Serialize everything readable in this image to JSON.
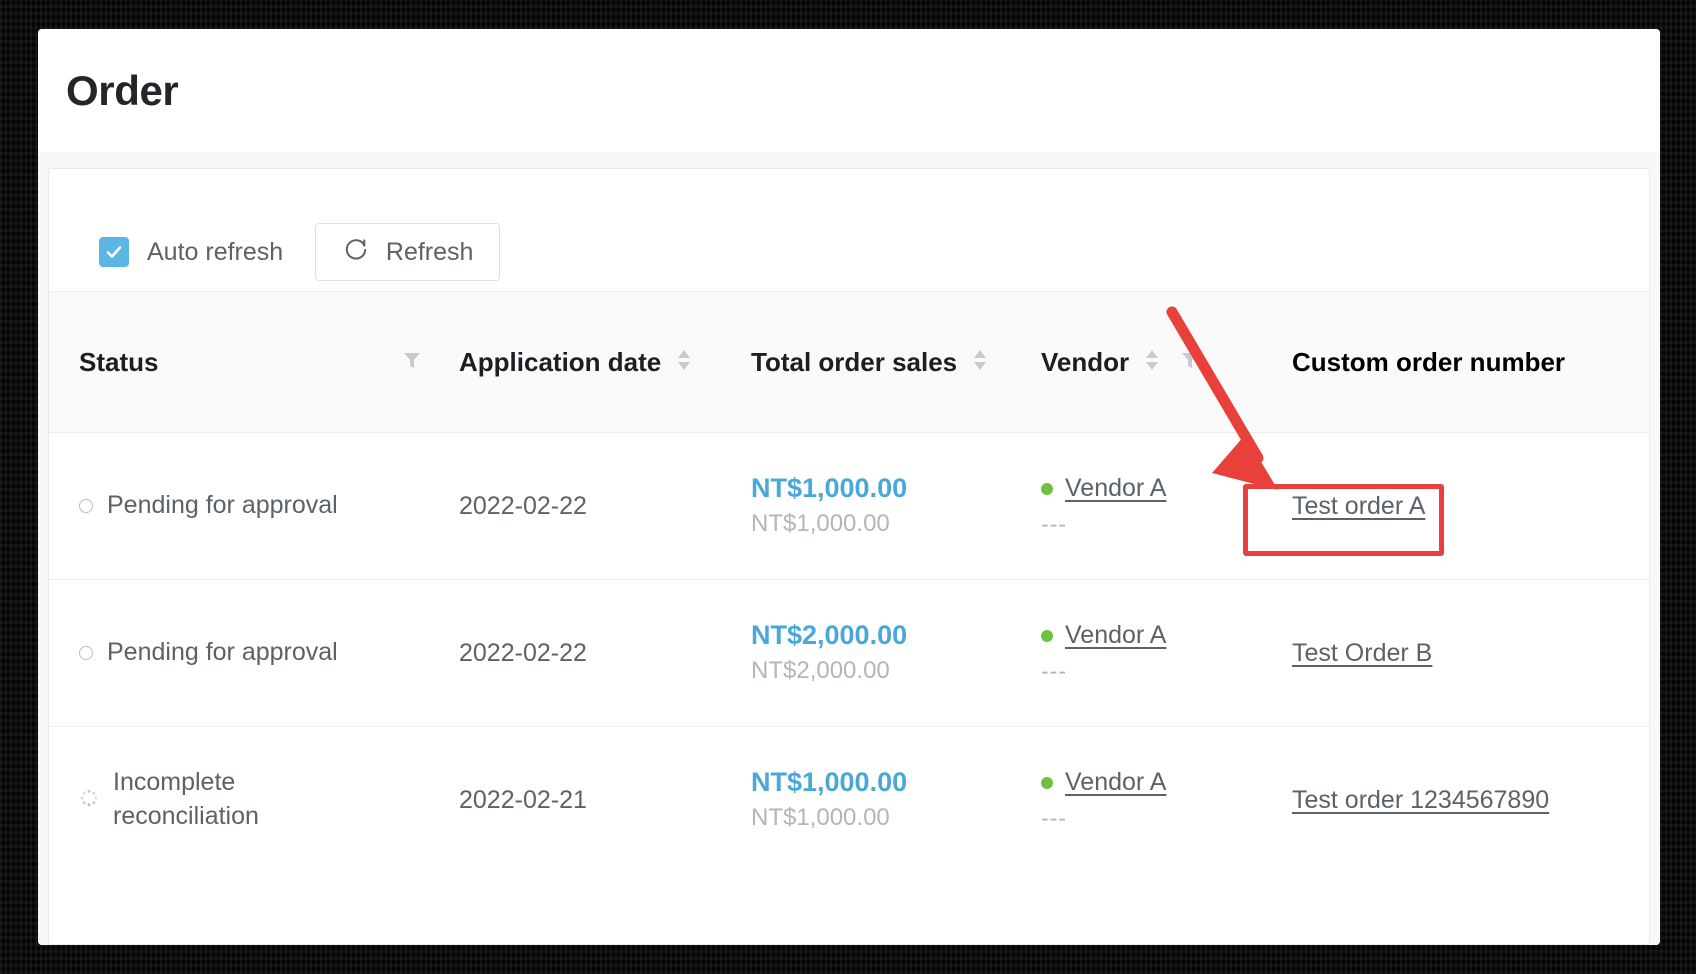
{
  "page": {
    "title": "Order"
  },
  "toolbar": {
    "auto_refresh_label": "Auto refresh",
    "auto_refresh_checked": true,
    "refresh_label": "Refresh",
    "refresh_icon": "refresh-icon",
    "checkbox_color": "#5cb6e4"
  },
  "table": {
    "columns": [
      {
        "label": "Status",
        "sortable": false,
        "filterable": true,
        "bold": false
      },
      {
        "label": "Application date",
        "sortable": true,
        "filterable": false,
        "bold": false
      },
      {
        "label": "Total order sales",
        "sortable": true,
        "filterable": false,
        "bold": false
      },
      {
        "label": "Vendor",
        "sortable": true,
        "filterable": true,
        "bold": false
      },
      {
        "label": "Custom order number",
        "sortable": false,
        "filterable": false,
        "bold": true
      }
    ],
    "rows": [
      {
        "status": "Pending for approval",
        "status_icon": "empty-circle-icon",
        "application_date": "2022-02-22",
        "sales_primary": "NT$1,000.00",
        "sales_secondary": "NT$1,000.00",
        "vendor": "Vendor A",
        "vendor_status_color": "#6dc341",
        "vendor_sub": "---",
        "custom_order_number": "Test order A"
      },
      {
        "status": "Pending for approval",
        "status_icon": "empty-circle-icon",
        "application_date": "2022-02-22",
        "sales_primary": "NT$2,000.00",
        "sales_secondary": "NT$2,000.00",
        "vendor": "Vendor A",
        "vendor_status_color": "#6dc341",
        "vendor_sub": "---",
        "custom_order_number": "Test Order B"
      },
      {
        "status": "Incomplete reconciliation",
        "status_icon": "spinner-icon",
        "application_date": "2022-02-21",
        "sales_primary": "NT$1,000.00",
        "sales_secondary": "NT$1,000.00",
        "vendor": "Vendor A",
        "vendor_status_color": "#6dc341",
        "vendor_sub": "---",
        "custom_order_number": "Test order 1234567890"
      }
    ]
  },
  "annotations": {
    "highlight_color": "#e8403a",
    "highlight_target": "Test order A",
    "arrow_icon": "down-right-arrow-icon"
  }
}
